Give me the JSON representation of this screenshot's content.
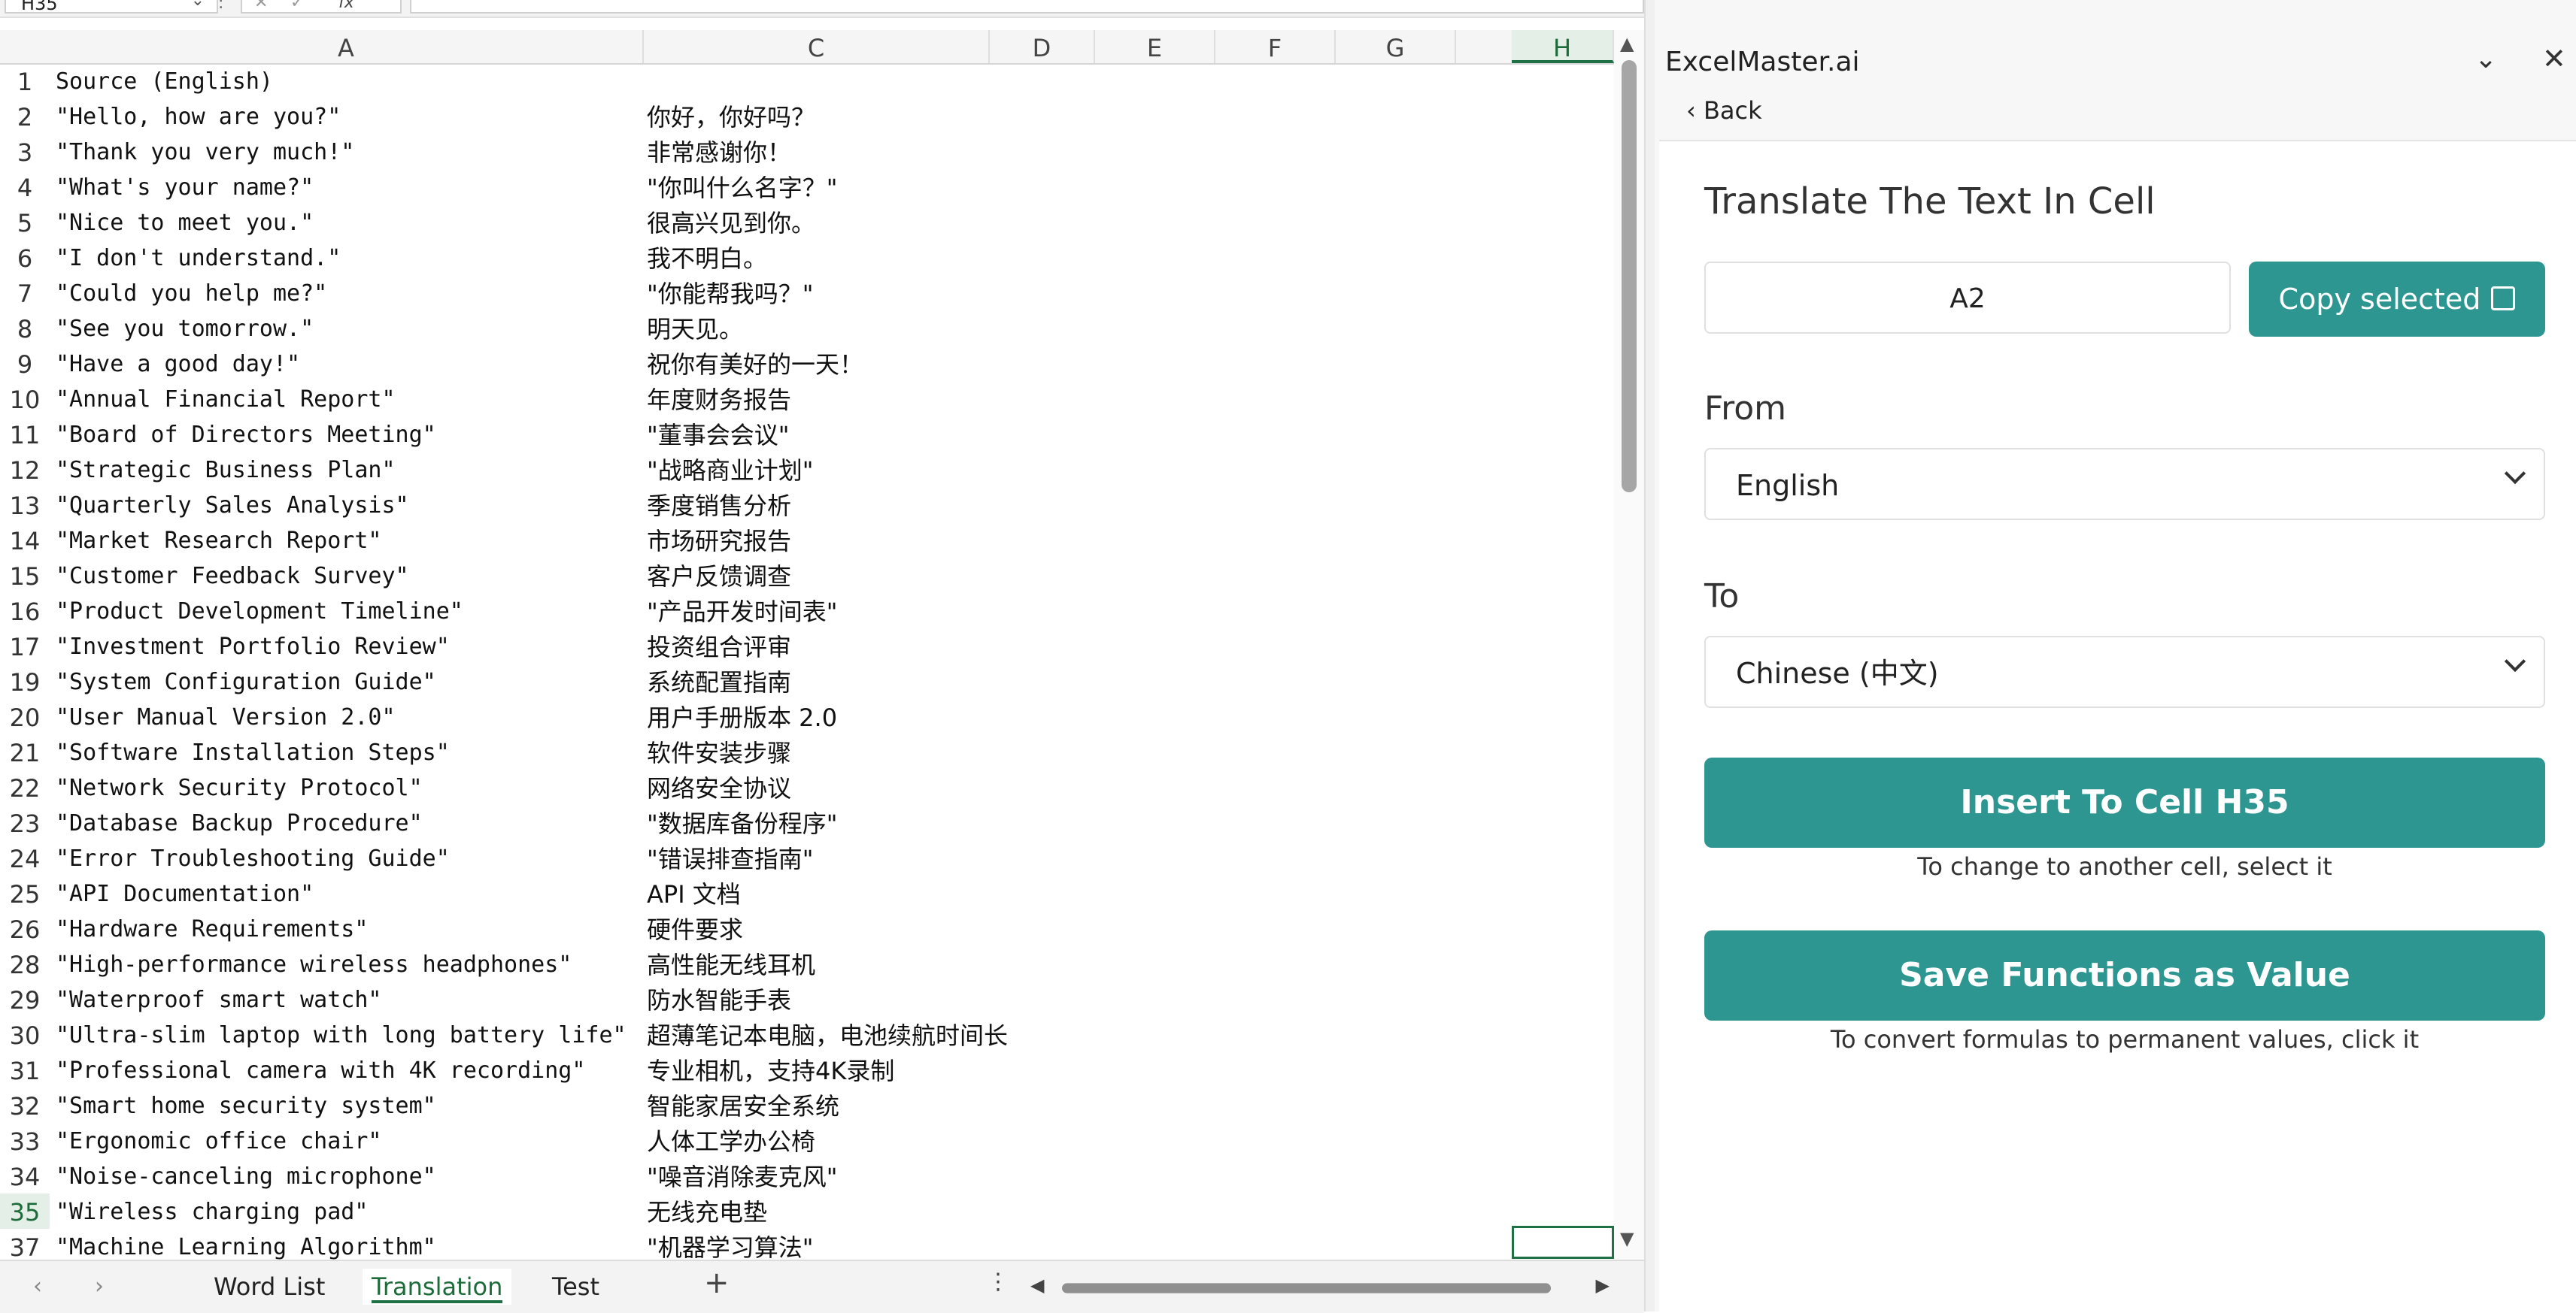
{
  "formula_bar": {
    "name_box": "H35",
    "sep": ":",
    "icons": [
      "cancel-icon",
      "enter-icon",
      "function-icon"
    ],
    "fx": "fx",
    "value": ""
  },
  "columns": [
    {
      "label": "A",
      "selected": false
    },
    {
      "label": "C",
      "selected": false
    },
    {
      "label": "D",
      "selected": false
    },
    {
      "label": "E",
      "selected": false
    },
    {
      "label": "F",
      "selected": false
    },
    {
      "label": "G",
      "selected": false
    },
    {
      "label": "H",
      "selected": true
    }
  ],
  "rows": [
    {
      "n": "1",
      "a": "Source (English)",
      "c": ""
    },
    {
      "n": "2",
      "a": "\"Hello, how are you?\"",
      "c": "你好，你好吗？"
    },
    {
      "n": "3",
      "a": "\"Thank you very much!\"",
      "c": "非常感谢你！"
    },
    {
      "n": "4",
      "a": "\"What's your name?\"",
      "c": "\"你叫什么名字？\""
    },
    {
      "n": "5",
      "a": "\"Nice to meet you.\"",
      "c": "很高兴见到你。"
    },
    {
      "n": "6",
      "a": "\"I don't understand.\"",
      "c": "我不明白。"
    },
    {
      "n": "7",
      "a": "\"Could you help me?\"",
      "c": "\"你能帮我吗？\""
    },
    {
      "n": "8",
      "a": "\"See you tomorrow.\"",
      "c": "明天见。"
    },
    {
      "n": "9",
      "a": "\"Have a good day!\"",
      "c": "祝你有美好的一天！"
    },
    {
      "n": "10",
      "a": "\"Annual Financial Report\"",
      "c": "年度财务报告"
    },
    {
      "n": "11",
      "a": "\"Board of Directors Meeting\"",
      "c": "\"董事会会议\""
    },
    {
      "n": "12",
      "a": "\"Strategic Business Plan\"",
      "c": "\"战略商业计划\""
    },
    {
      "n": "13",
      "a": "\"Quarterly Sales Analysis\"",
      "c": "季度销售分析"
    },
    {
      "n": "14",
      "a": "\"Market Research Report\"",
      "c": "市场研究报告"
    },
    {
      "n": "15",
      "a": "\"Customer Feedback Survey\"",
      "c": "客户反馈调查"
    },
    {
      "n": "16",
      "a": "\"Product Development Timeline\"",
      "c": "\"产品开发时间表\""
    },
    {
      "n": "17",
      "a": "\"Investment Portfolio Review\"",
      "c": "投资组合评审"
    },
    {
      "n": "19",
      "a": "\"System Configuration Guide\"",
      "c": "系统配置指南"
    },
    {
      "n": "20",
      "a": "\"User Manual Version 2.0\"",
      "c": "用户手册版本 2.0"
    },
    {
      "n": "21",
      "a": "\"Software Installation Steps\"",
      "c": "软件安装步骤"
    },
    {
      "n": "22",
      "a": "\"Network Security Protocol\"",
      "c": "网络安全协议"
    },
    {
      "n": "23",
      "a": "\"Database Backup Procedure\"",
      "c": "\"数据库备份程序\""
    },
    {
      "n": "24",
      "a": "\"Error Troubleshooting Guide\"",
      "c": "\"错误排查指南\""
    },
    {
      "n": "25",
      "a": "\"API Documentation\"",
      "c": "API 文档"
    },
    {
      "n": "26",
      "a": "\"Hardware Requirements\"",
      "c": "硬件要求"
    },
    {
      "n": "28",
      "a": "\"High-performance wireless headphones\"",
      "c": "高性能无线耳机"
    },
    {
      "n": "29",
      "a": "\"Waterproof smart watch\"",
      "c": "防水智能手表"
    },
    {
      "n": "30",
      "a": "\"Ultra-slim laptop with long battery life\"",
      "c": "超薄笔记本电脑，电池续航时间长"
    },
    {
      "n": "31",
      "a": "\"Professional camera with 4K recording\"",
      "c": "专业相机，支持4K录制"
    },
    {
      "n": "32",
      "a": "\"Smart home security system\"",
      "c": "智能家居安全系统"
    },
    {
      "n": "33",
      "a": "\"Ergonomic office chair\"",
      "c": "人体工学办公椅"
    },
    {
      "n": "34",
      "a": "\"Noise-canceling microphone\"",
      "c": "\"噪音消除麦克风\""
    },
    {
      "n": "35",
      "a": "\"Wireless charging pad\"",
      "c": "无线充电垫",
      "selected": true
    },
    {
      "n": "37",
      "a": "\"Machine Learning Algorithm\"",
      "c": "\"机器学习算法\""
    }
  ],
  "sheet_tabs": [
    {
      "label": "Word List",
      "active": false
    },
    {
      "label": "Translation",
      "active": true
    },
    {
      "label": "Test",
      "active": false
    }
  ],
  "tabs_extra": {
    "add": "+",
    "more": "⋮",
    "prev": "‹",
    "next": "›"
  },
  "pane": {
    "title": "ExcelMaster.ai",
    "back_label": "Back",
    "heading": "Translate The Text In Cell",
    "cell_ref": "A2",
    "copy_label": "Copy selected",
    "from_label": "From",
    "from_value": "English",
    "to_label": "To",
    "to_value": "Chinese (中文)",
    "insert_label": "Insert To Cell H35",
    "insert_hint": "To change to another cell, select it",
    "save_label": "Save Functions as Value",
    "save_hint": "To convert formulas to permanent values, click it"
  },
  "colors": {
    "accent": "#2e9690",
    "excel_green": "#1e7145",
    "selected_header_bg": "#e3efe7"
  }
}
